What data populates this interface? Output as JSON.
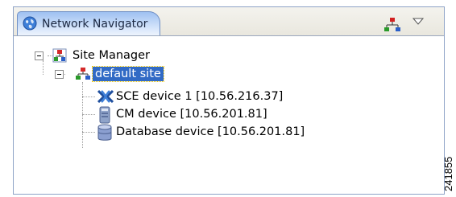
{
  "panel": {
    "tab_title": "Network Navigator",
    "tab_icon": "globe-icon",
    "view_toolbar_icon": "network-topology-icon",
    "view_menu_icon": "view-menu-chevron-icon",
    "accent_color": "#316ac5",
    "tab_gradient": "#9ec0f1"
  },
  "tree": {
    "root": {
      "label": "Site Manager",
      "icon": "site-manager-icon",
      "expanded": true
    },
    "site": {
      "label": "default site",
      "icon": "site-icon",
      "expanded": true,
      "selected": true
    },
    "devices": [
      {
        "label": "SCE device 1 [10.56.216.37]",
        "icon": "sce-device-icon"
      },
      {
        "label": "CM device [10.56.201.81]",
        "icon": "cm-device-icon"
      },
      {
        "label": "Database  device [10.56.201.81]",
        "icon": "database-icon"
      }
    ]
  },
  "figure_id": "241855"
}
